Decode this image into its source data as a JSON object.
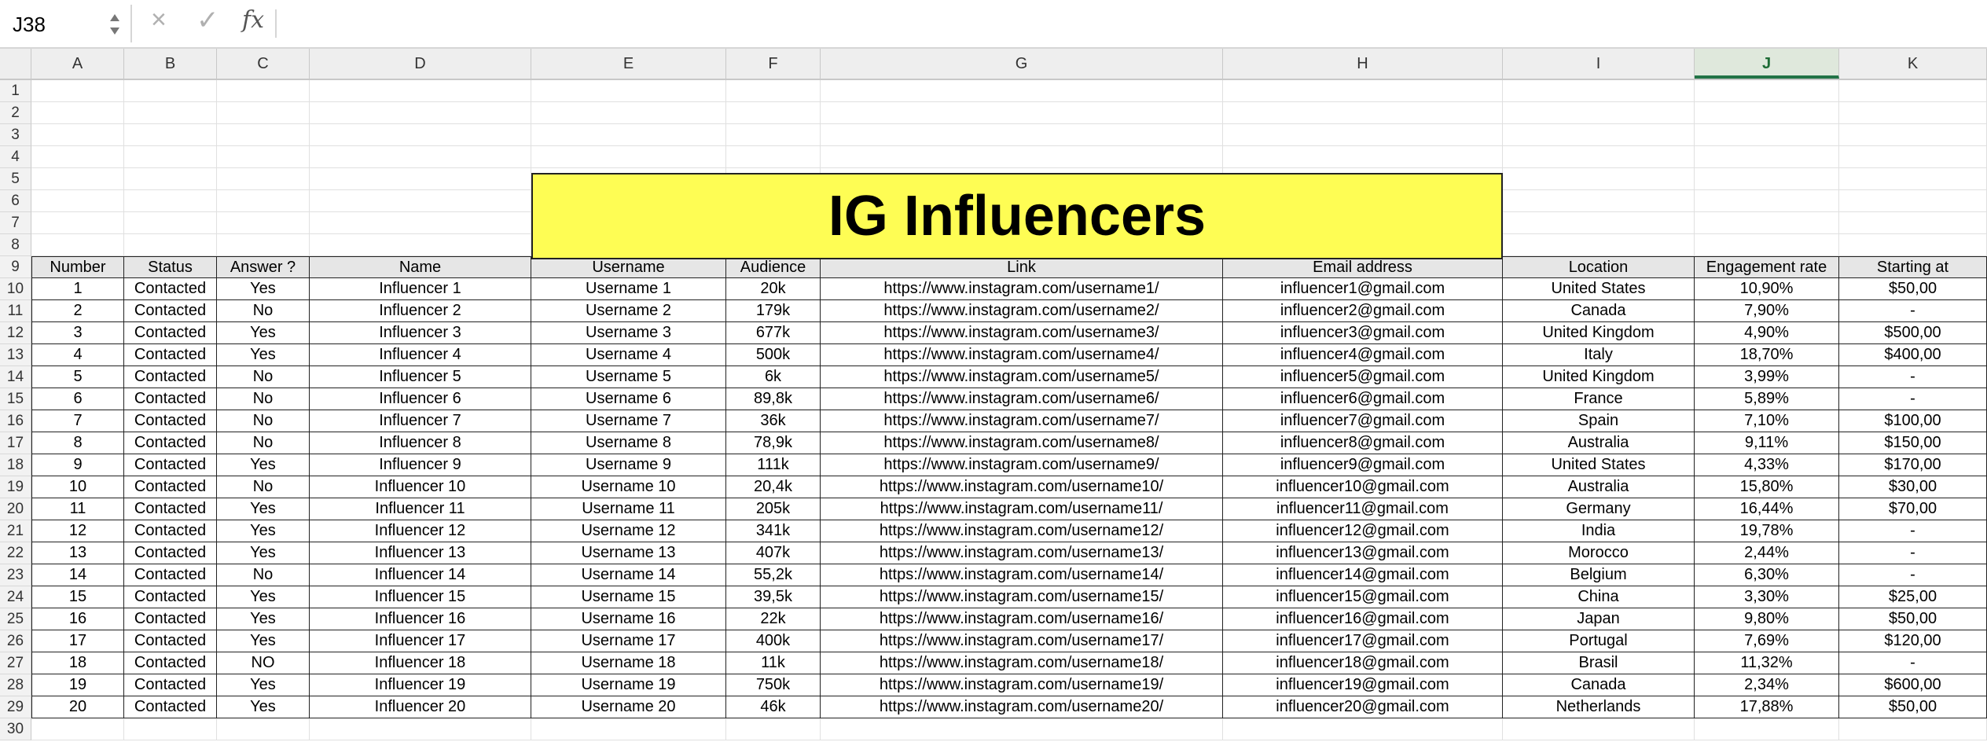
{
  "formula_bar": {
    "name_box": "J38",
    "cancel_icon": "×",
    "confirm_icon": "✓",
    "fx_label": "fx",
    "formula": ""
  },
  "columns": [
    "A",
    "B",
    "C",
    "D",
    "E",
    "F",
    "G",
    "H",
    "I",
    "J",
    "K"
  ],
  "selected_column": "J",
  "row_numbers": [
    "1",
    "2",
    "3",
    "4",
    "5",
    "6",
    "7",
    "8",
    "9",
    "10",
    "11",
    "12",
    "13",
    "14",
    "15",
    "16",
    "17",
    "18",
    "19",
    "20",
    "21",
    "22",
    "23",
    "24",
    "25",
    "26",
    "27",
    "28",
    "29",
    "30"
  ],
  "title": "IG Influencers",
  "table": {
    "headers": [
      "Number",
      "Status",
      "Answer ?",
      "Name",
      "Username",
      "Audience",
      "Link",
      "Email address",
      "Location",
      "Engagement rate",
      "Starting at"
    ],
    "rows": [
      [
        "1",
        "Contacted",
        "Yes",
        "Influencer 1",
        "Username 1",
        "20k",
        "https://www.instagram.com/username1/",
        "influencer1@gmail.com",
        "United States",
        "10,90%",
        "$50,00"
      ],
      [
        "2",
        "Contacted",
        "No",
        "Influencer 2",
        "Username 2",
        "179k",
        "https://www.instagram.com/username2/",
        "influencer2@gmail.com",
        "Canada",
        "7,90%",
        "-"
      ],
      [
        "3",
        "Contacted",
        "Yes",
        "Influencer 3",
        "Username 3",
        "677k",
        "https://www.instagram.com/username3/",
        "influencer3@gmail.com",
        "United Kingdom",
        "4,90%",
        "$500,00"
      ],
      [
        "4",
        "Contacted",
        "Yes",
        "Influencer 4",
        "Username 4",
        "500k",
        "https://www.instagram.com/username4/",
        "influencer4@gmail.com",
        "Italy",
        "18,70%",
        "$400,00"
      ],
      [
        "5",
        "Contacted",
        "No",
        "Influencer 5",
        "Username 5",
        "6k",
        "https://www.instagram.com/username5/",
        "influencer5@gmail.com",
        "United Kingdom",
        "3,99%",
        "-"
      ],
      [
        "6",
        "Contacted",
        "No",
        "Influencer 6",
        "Username 6",
        "89,8k",
        "https://www.instagram.com/username6/",
        "influencer6@gmail.com",
        "France",
        "5,89%",
        "-"
      ],
      [
        "7",
        "Contacted",
        "No",
        "Influencer 7",
        "Username 7",
        "36k",
        "https://www.instagram.com/username7/",
        "influencer7@gmail.com",
        "Spain",
        "7,10%",
        "$100,00"
      ],
      [
        "8",
        "Contacted",
        "No",
        "Influencer 8",
        "Username 8",
        "78,9k",
        "https://www.instagram.com/username8/",
        "influencer8@gmail.com",
        "Australia",
        "9,11%",
        "$150,00"
      ],
      [
        "9",
        "Contacted",
        "Yes",
        "Influencer 9",
        "Username 9",
        "111k",
        "https://www.instagram.com/username9/",
        "influencer9@gmail.com",
        "United States",
        "4,33%",
        "$170,00"
      ],
      [
        "10",
        "Contacted",
        "No",
        "Influencer 10",
        "Username 10",
        "20,4k",
        "https://www.instagram.com/username10/",
        "influencer10@gmail.com",
        "Australia",
        "15,80%",
        "$30,00"
      ],
      [
        "11",
        "Contacted",
        "Yes",
        "Influencer 11",
        "Username 11",
        "205k",
        "https://www.instagram.com/username11/",
        "influencer11@gmail.com",
        "Germany",
        "16,44%",
        "$70,00"
      ],
      [
        "12",
        "Contacted",
        "Yes",
        "Influencer 12",
        "Username 12",
        "341k",
        "https://www.instagram.com/username12/",
        "influencer12@gmail.com",
        "India",
        "19,78%",
        "-"
      ],
      [
        "13",
        "Contacted",
        "Yes",
        "Influencer 13",
        "Username 13",
        "407k",
        "https://www.instagram.com/username13/",
        "influencer13@gmail.com",
        "Morocco",
        "2,44%",
        "-"
      ],
      [
        "14",
        "Contacted",
        "No",
        "Influencer 14",
        "Username 14",
        "55,2k",
        "https://www.instagram.com/username14/",
        "influencer14@gmail.com",
        "Belgium",
        "6,30%",
        "-"
      ],
      [
        "15",
        "Contacted",
        "Yes",
        "Influencer 15",
        "Username 15",
        "39,5k",
        "https://www.instagram.com/username15/",
        "influencer15@gmail.com",
        "China",
        "3,30%",
        "$25,00"
      ],
      [
        "16",
        "Contacted",
        "Yes",
        "Influencer 16",
        "Username 16",
        "22k",
        "https://www.instagram.com/username16/",
        "influencer16@gmail.com",
        "Japan",
        "9,80%",
        "$50,00"
      ],
      [
        "17",
        "Contacted",
        "Yes",
        "Influencer 17",
        "Username 17",
        "400k",
        "https://www.instagram.com/username17/",
        "influencer17@gmail.com",
        "Portugal",
        "7,69%",
        "$120,00"
      ],
      [
        "18",
        "Contacted",
        "NO",
        "Influencer 18",
        "Username 18",
        "11k",
        "https://www.instagram.com/username18/",
        "influencer18@gmail.com",
        "Brasil",
        "11,32%",
        "-"
      ],
      [
        "19",
        "Contacted",
        "Yes",
        "Influencer 19",
        "Username 19",
        "750k",
        "https://www.instagram.com/username19/",
        "influencer19@gmail.com",
        "Canada",
        "2,34%",
        "$600,00"
      ],
      [
        "20",
        "Contacted",
        "Yes",
        "Influencer 20",
        "Username 20",
        "46k",
        "https://www.instagram.com/username20/",
        "influencer20@gmail.com",
        "Netherlands",
        "17,88%",
        "$50,00"
      ]
    ]
  },
  "colors": {
    "title_fill": "#fefd54",
    "header_fill": "#e6e6e6",
    "selected_column_accent": "#217346"
  }
}
